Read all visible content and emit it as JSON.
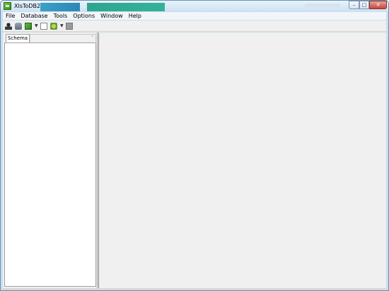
{
  "window": {
    "title": "XlsToDB2"
  },
  "menu": [
    "File",
    "Database",
    "Tools",
    "Options",
    "Window",
    "Help"
  ],
  "toolbar": {
    "icons": [
      "user-icon",
      "database-icon",
      "export-icon",
      "dropdown-arrow-icon",
      "document-icon",
      "settings-icon",
      "dropdown-arrow-icon",
      "stop-icon"
    ]
  },
  "left_panel": {
    "tab_label": "Schema",
    "chevron": "˄"
  },
  "colors": {
    "title_gradient_top": "#e9f3fb",
    "panel_bg": "#f0f0f0",
    "close_button": "#c8463a"
  }
}
